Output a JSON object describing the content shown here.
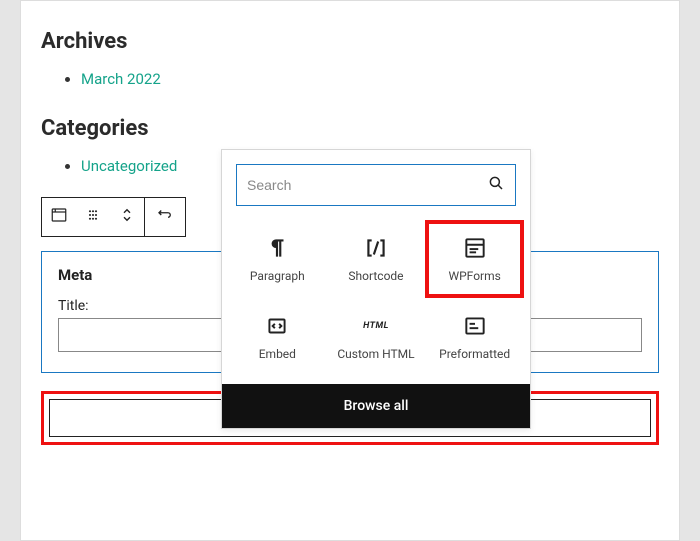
{
  "archives": {
    "heading": "Archives",
    "items": [
      "March 2022"
    ]
  },
  "categories": {
    "heading": "Categories",
    "items": [
      "Uncategorized"
    ]
  },
  "meta_widget": {
    "name": "Meta",
    "title_label": "Title:",
    "title_value": ""
  },
  "inserter": {
    "search_placeholder": "Search",
    "blocks": [
      {
        "label": "Paragraph"
      },
      {
        "label": "Shortcode"
      },
      {
        "label": "WPForms"
      },
      {
        "label": "Embed"
      },
      {
        "label": "Custom HTML"
      },
      {
        "label": "Preformatted"
      }
    ],
    "browse_all": "Browse all"
  }
}
